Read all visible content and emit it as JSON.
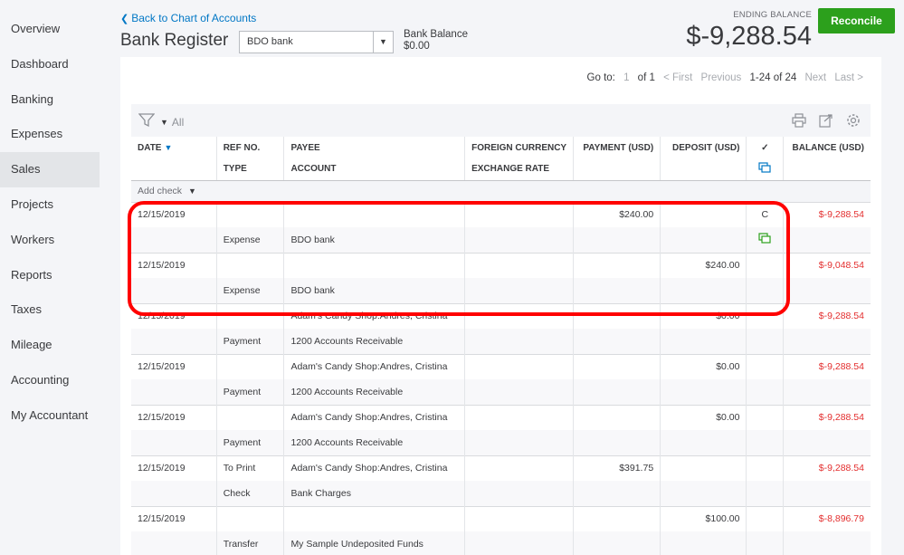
{
  "sidebar": {
    "items": [
      {
        "label": "Overview",
        "active": false
      },
      {
        "label": "Dashboard",
        "active": false
      },
      {
        "label": "Banking",
        "active": false
      },
      {
        "label": "Expenses",
        "active": false
      },
      {
        "label": "Sales",
        "active": true
      },
      {
        "label": "Projects",
        "active": false
      },
      {
        "label": "Workers",
        "active": false
      },
      {
        "label": "Reports",
        "active": false
      },
      {
        "label": "Taxes",
        "active": false
      },
      {
        "label": "Mileage",
        "active": false
      },
      {
        "label": "Accounting",
        "active": false
      },
      {
        "label": "My Accountant",
        "active": false
      }
    ]
  },
  "header": {
    "back_link": "Back to Chart of Accounts",
    "title": "Bank Register",
    "account_selected": "BDO bank",
    "bank_balance_label": "Bank Balance",
    "bank_balance_value": "$0.00",
    "ending_balance_label": "ENDING BALANCE",
    "ending_balance_value": "$-9,288.54",
    "reconcile_label": "Reconcile"
  },
  "pager": {
    "goto_label": "Go to:",
    "page": "1",
    "of_label": "of 1",
    "first": "< First",
    "previous": "Previous",
    "range": "1-24 of 24",
    "next": "Next",
    "last": "Last >"
  },
  "toolbar": {
    "filter_label": "All",
    "icons": [
      "print-icon",
      "export-icon",
      "settings-icon"
    ]
  },
  "columns": {
    "date": "DATE",
    "ref_no": "REF NO.",
    "type": "TYPE",
    "payee": "PAYEE",
    "account": "ACCOUNT",
    "foreign_currency": "FOREIGN CURRENCY",
    "exchange_rate": "EXCHANGE RATE",
    "payment": "PAYMENT (USD)",
    "deposit": "DEPOSIT (USD)",
    "reconcile_mark": "✓",
    "balance": "BALANCE (USD)"
  },
  "add_check_label": "Add check",
  "colors": {
    "accent": "#0077c5",
    "reconcile_button": "#2ca01c",
    "negative_balance": "#e32e2e",
    "highlight_box": "#ff0000"
  },
  "rows": [
    {
      "date": "12/15/2019",
      "ref_no": "",
      "payee": "",
      "payment": "$240.00",
      "deposit": "",
      "status": "C",
      "balance": "$-9,288.54",
      "type": "Expense",
      "account": "BDO bank",
      "attachment_icon": true
    },
    {
      "date": "12/15/2019",
      "ref_no": "",
      "payee": "",
      "payment": "",
      "deposit": "$240.00",
      "status": "",
      "balance": "$-9,048.54",
      "type": "Expense",
      "account": "BDO bank",
      "attachment_icon": false
    },
    {
      "date": "12/15/2019",
      "ref_no": "",
      "payee": "Adam's Candy Shop:Andres, Cristina",
      "payment": "",
      "deposit": "$0.00",
      "status": "",
      "balance": "$-9,288.54",
      "type": "Payment",
      "account": "1200 Accounts Receivable",
      "attachment_icon": false
    },
    {
      "date": "12/15/2019",
      "ref_no": "",
      "payee": "Adam's Candy Shop:Andres, Cristina",
      "payment": "",
      "deposit": "$0.00",
      "status": "",
      "balance": "$-9,288.54",
      "type": "Payment",
      "account": "1200 Accounts Receivable",
      "attachment_icon": false
    },
    {
      "date": "12/15/2019",
      "ref_no": "",
      "payee": "Adam's Candy Shop:Andres, Cristina",
      "payment": "",
      "deposit": "$0.00",
      "status": "",
      "balance": "$-9,288.54",
      "type": "Payment",
      "account": "1200 Accounts Receivable",
      "attachment_icon": false
    },
    {
      "date": "12/15/2019",
      "ref_no": "To Print",
      "payee": "Adam's Candy Shop:Andres, Cristina",
      "payment": "$391.75",
      "deposit": "",
      "status": "",
      "balance": "$-9,288.54",
      "type": "Check",
      "account": "Bank Charges",
      "attachment_icon": false
    },
    {
      "date": "12/15/2019",
      "ref_no": "",
      "payee": "",
      "payment": "",
      "deposit": "$100.00",
      "status": "",
      "balance": "$-8,896.79",
      "type": "Transfer",
      "account": "My Sample Undeposited Funds",
      "attachment_icon": false
    }
  ]
}
